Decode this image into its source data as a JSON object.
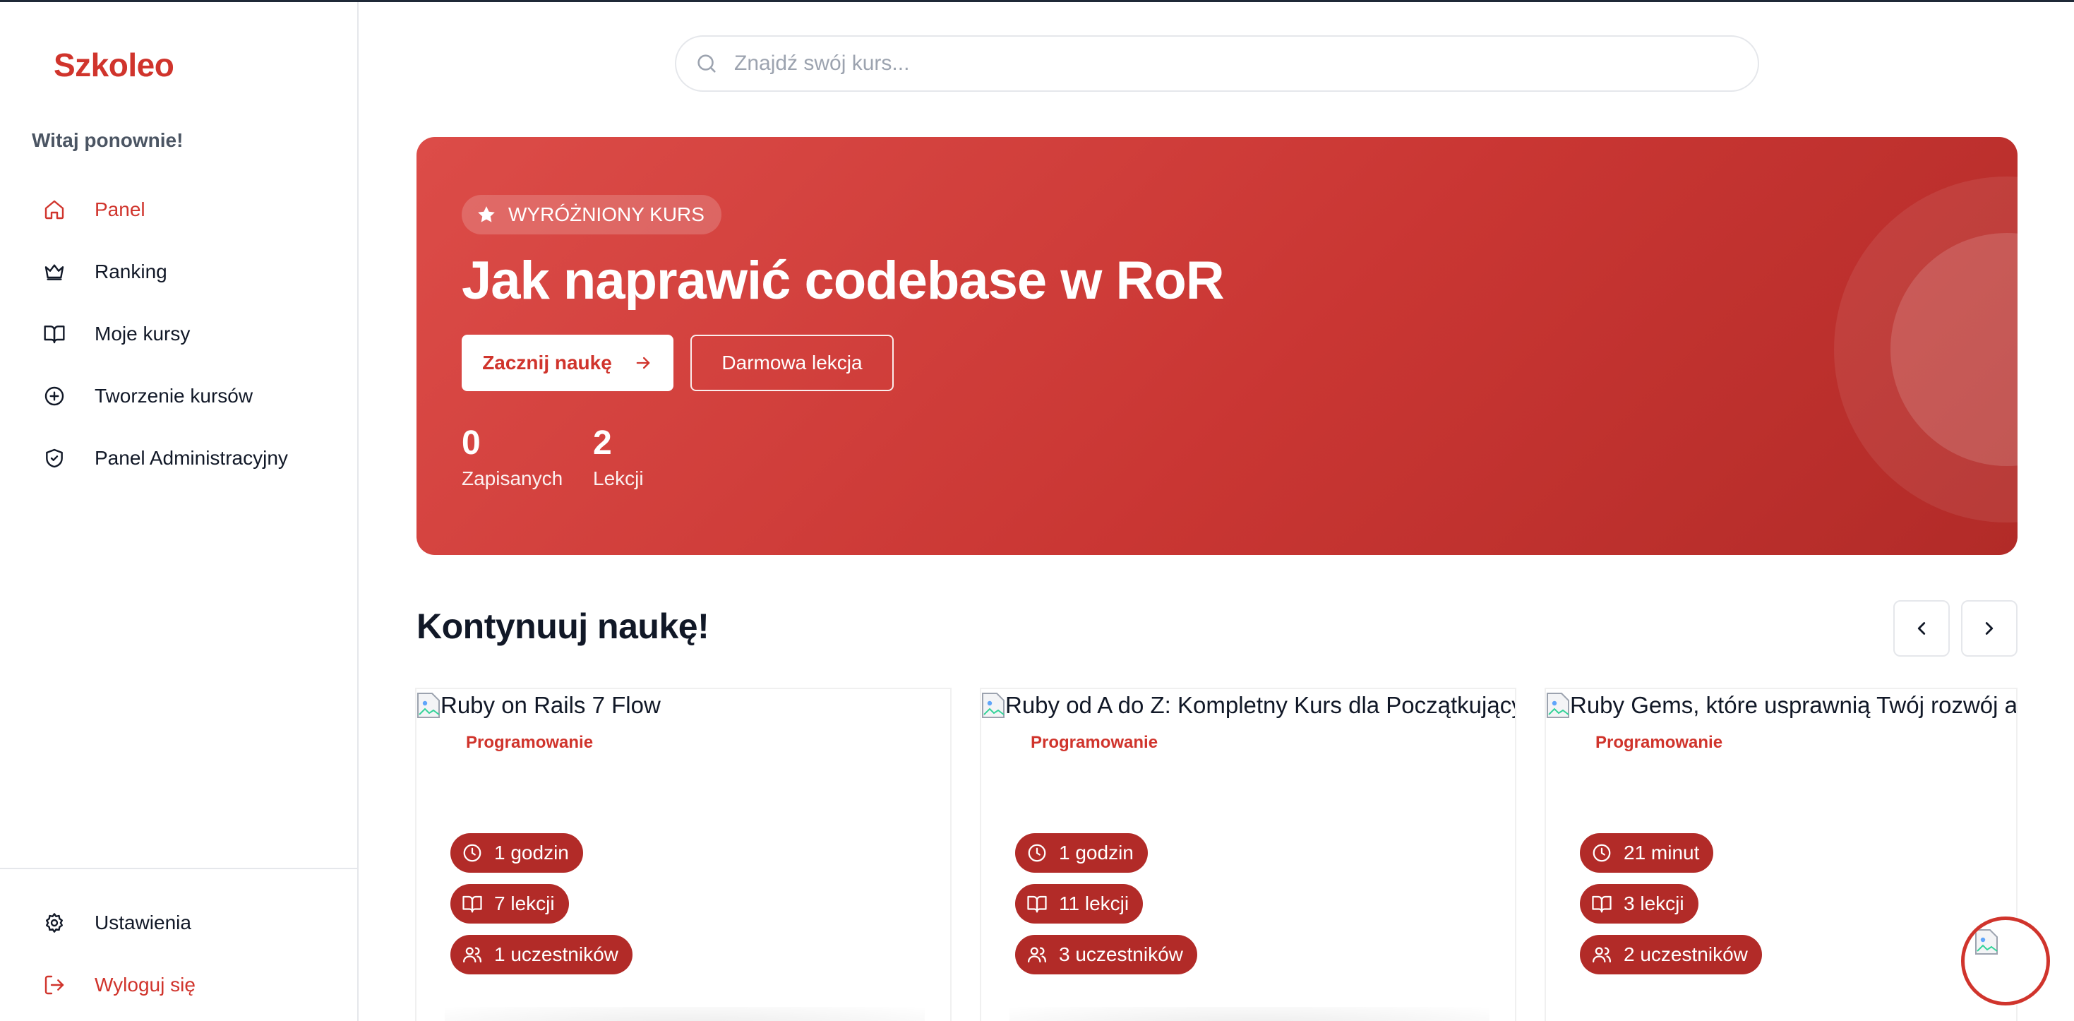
{
  "app": {
    "logo": "Szkoleo",
    "accent": "#d0342c"
  },
  "sidebar": {
    "welcome": "Witaj ponownie!",
    "items": [
      {
        "label": "Panel",
        "icon": "home-icon",
        "active": true
      },
      {
        "label": "Ranking",
        "icon": "crown-icon"
      },
      {
        "label": "Moje kursy",
        "icon": "book-icon"
      },
      {
        "label": "Tworzenie kursów",
        "icon": "plus-circle-icon"
      },
      {
        "label": "Panel Administracyjny",
        "icon": "shield-check-icon"
      }
    ],
    "bottom": [
      {
        "label": "Ustawienia",
        "icon": "gear-icon"
      },
      {
        "label": "Wyloguj się",
        "icon": "logout-icon"
      }
    ]
  },
  "search": {
    "placeholder": "Znajdź swój kurs..."
  },
  "hero": {
    "badge": "WYRÓŻNIONY KURS",
    "title": "Jak naprawić codebase w RoR",
    "primary_button": "Zacznij naukę",
    "secondary_button": "Darmowa lekcja",
    "stats": [
      {
        "value": "0",
        "label": "Zapisanych"
      },
      {
        "value": "2",
        "label": "Lekcji"
      }
    ]
  },
  "continue": {
    "title": "Kontynuuj naukę!",
    "courses": [
      {
        "image_alt": "Ruby on Rails 7 Flow",
        "category": "Programowanie",
        "duration": "1 godzin",
        "lessons": "7 lekcji",
        "participants": "1 uczestników"
      },
      {
        "image_alt": "Ruby od A do Z: Kompletny Kurs dla Początkujących",
        "category": "Programowanie",
        "duration": "1 godzin",
        "lessons": "11 lekcji",
        "participants": "3 uczestników"
      },
      {
        "image_alt": "Ruby Gems, które usprawnią Twój rozwój aplikacji",
        "category": "Programowanie",
        "duration": "21 minut",
        "lessons": "3 lekcji",
        "participants": "2 uczestników"
      }
    ]
  }
}
